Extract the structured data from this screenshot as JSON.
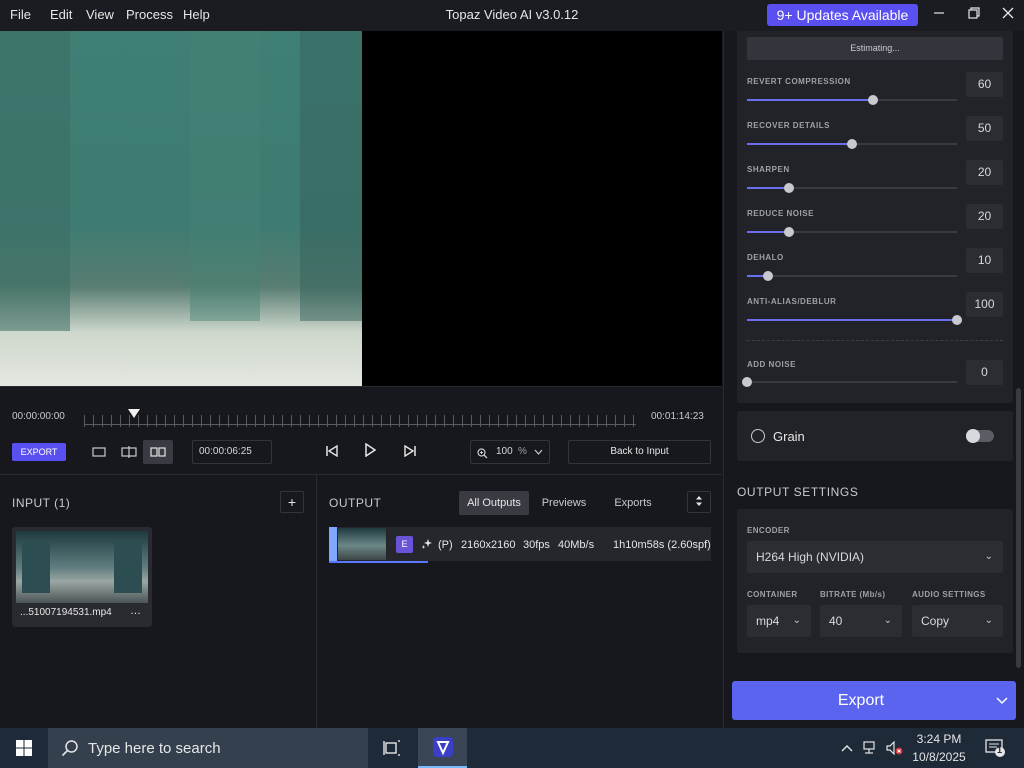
{
  "app": {
    "title": "Topaz Video AI  v3.0.12",
    "menu": [
      "File",
      "Edit",
      "View",
      "Process",
      "Help"
    ],
    "updates_label": "9+ Updates Available",
    "accent_color": "#5a4ff0"
  },
  "timeline": {
    "start_time": "00:00:00:00",
    "end_time": "00:01:14:23",
    "current_timecode": "00:00:06:25",
    "playhead_fraction": 0.09,
    "export_label": "EXPORT",
    "zoom_value": "100",
    "zoom_unit": "%",
    "back_to_input_label": "Back to Input"
  },
  "input": {
    "heading": "INPUT (1)",
    "add_label": "+",
    "file_name": "...51007194531.mp4",
    "more_label": "…"
  },
  "output": {
    "heading": "OUTPUT",
    "tabs": [
      "All Outputs",
      "Previews",
      "Exports"
    ],
    "active_tab": "All Outputs",
    "row": {
      "badge": "E",
      "mode": "(P)",
      "resolution": "2160x2160",
      "fps": "30fps",
      "bitrate": "40Mb/s",
      "eta": "1h10m58s (2.60spf)"
    },
    "progress_fraction": 0.26
  },
  "settings": {
    "estimating_label": "Estimating...",
    "sliders": [
      {
        "label": "REVERT COMPRESSION",
        "value": 60
      },
      {
        "label": "RECOVER DETAILS",
        "value": 50
      },
      {
        "label": "SHARPEN",
        "value": 20
      },
      {
        "label": "REDUCE NOISE",
        "value": 20
      },
      {
        "label": "DEHALO",
        "value": 10
      },
      {
        "label": "ANTI-ALIAS/DEBLUR",
        "value": 100
      }
    ],
    "add_noise": {
      "label": "ADD NOISE",
      "value": 0
    },
    "grain_label": "Grain",
    "grain_enabled": false
  },
  "output_settings": {
    "heading": "OUTPUT SETTINGS",
    "encoder_label": "ENCODER",
    "encoder_value": "H264 High (NVIDIA)",
    "container_label": "CONTAINER",
    "container_value": "mp4",
    "bitrate_label": "BITRATE (Mb/s)",
    "bitrate_value": "40",
    "audio_label": "AUDIO SETTINGS",
    "audio_value": "Copy",
    "export_button": "Export"
  },
  "taskbar": {
    "search_placeholder": "Type here to search",
    "time": "3:24 PM",
    "date": "10/8/2025",
    "notification_count": "1"
  }
}
